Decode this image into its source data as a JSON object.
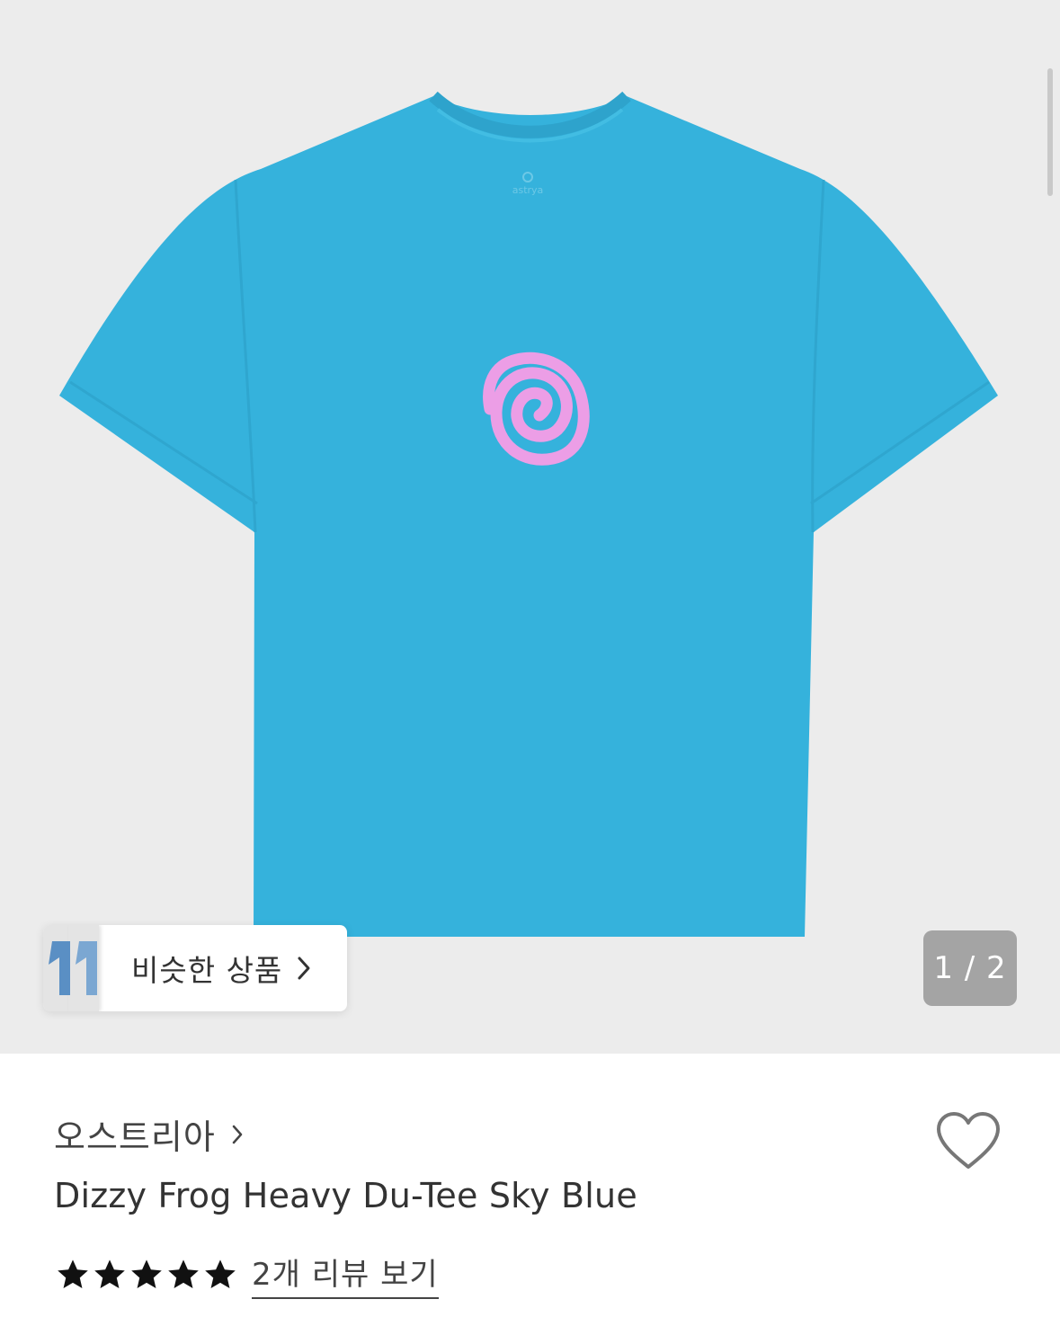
{
  "gallery": {
    "background": "#ececec",
    "product_image": {
      "icon": "tshirt-image",
      "shirt_color": "#35b2dc",
      "print_color": "#ec9ee6",
      "print": "spiral-icon",
      "neck_label": "astrya"
    },
    "similar_products": {
      "label": "비슷한 상품",
      "icon": "chevron-right-icon"
    },
    "page_counter": "1 / 2"
  },
  "product": {
    "brand": "오스트리아",
    "title": "Dizzy Frog Heavy Du-Tee Sky Blue",
    "rating": {
      "stars": 5,
      "max_stars": 5,
      "review_link": "2개 리뷰 보기"
    },
    "wishlist_icon": "heart-outline-icon"
  }
}
